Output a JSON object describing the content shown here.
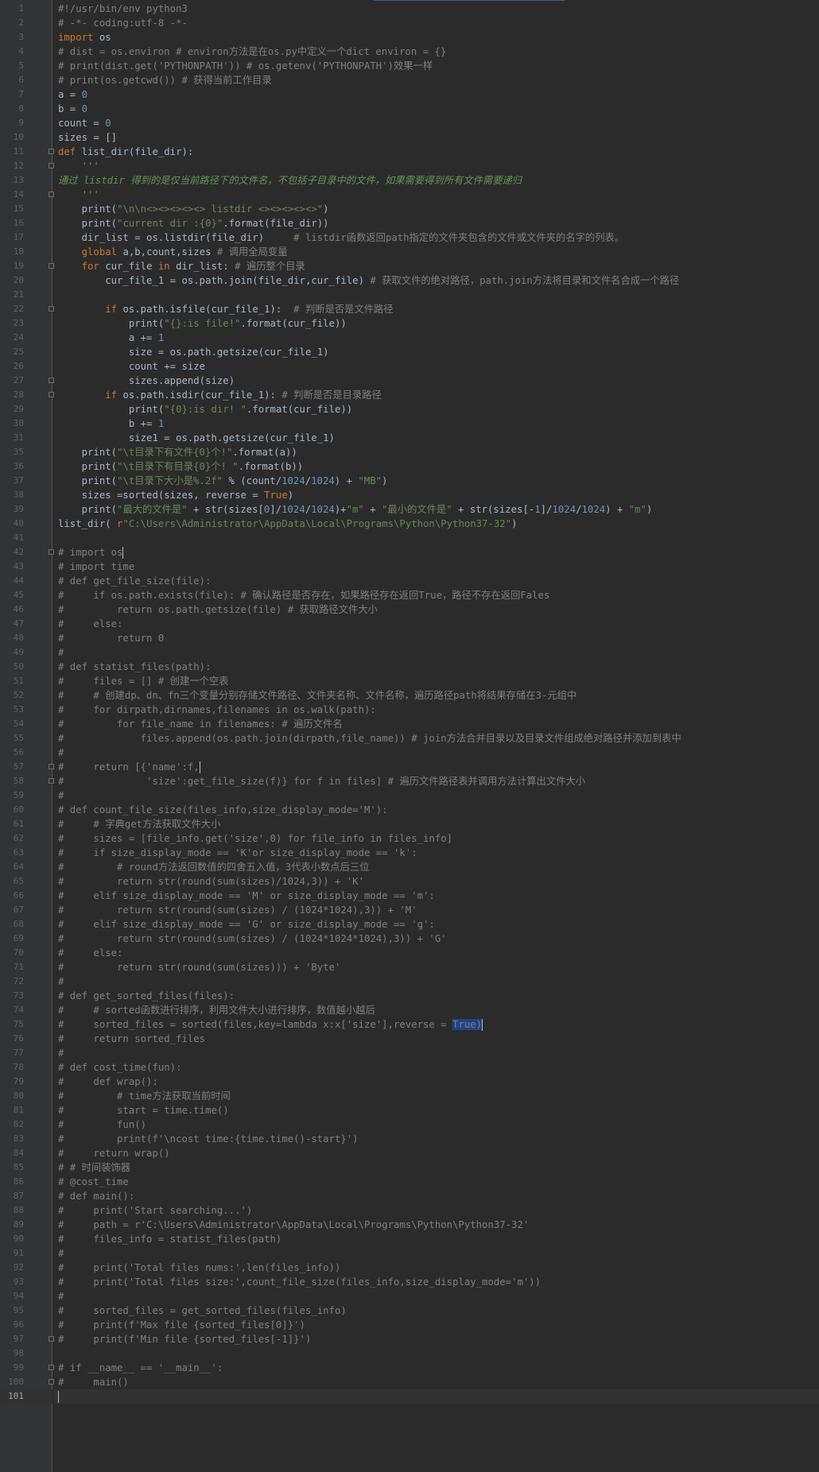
{
  "editor": {
    "current_line": 101,
    "lines": [
      {
        "n": 1,
        "text": "#!/usr/bin/env python3",
        "kind": "comment"
      },
      {
        "n": 2,
        "text": "# -*- coding:utf-8 -*-",
        "kind": "comment"
      },
      {
        "n": 3,
        "text": "import os",
        "kind": "import"
      },
      {
        "n": 4,
        "text": "# dist = os.environ # environ方法是在os.py中定义一个dict environ = {}",
        "kind": "comment"
      },
      {
        "n": 5,
        "text": "# print(dist.get('PYTHONPATH')) # os.getenv('PYTHONPATH')效果一样",
        "kind": "comment"
      },
      {
        "n": 6,
        "text": "# print(os.getcwd()) # 获得当前工作目录",
        "kind": "comment"
      },
      {
        "n": 7,
        "text": "a = 0",
        "kind": "code"
      },
      {
        "n": 8,
        "text": "b = 0",
        "kind": "code"
      },
      {
        "n": 9,
        "text": "count = 0",
        "kind": "code"
      },
      {
        "n": 10,
        "text": "sizes = []",
        "kind": "code"
      },
      {
        "n": 11,
        "text": "def list_dir(file_dir):",
        "kind": "def"
      },
      {
        "n": 12,
        "text": "    '''",
        "kind": "doc"
      },
      {
        "n": 13,
        "text": "通过 listdir 得到的是仅当前路径下的文件名，不包括子目录中的文件，如果需要得到所有文件需要递归",
        "kind": "doc"
      },
      {
        "n": 14,
        "text": "    '''",
        "kind": "doc"
      },
      {
        "n": 15,
        "text": "    print(\"\\n\\n<><><><><> listdir <><><><><>\")",
        "kind": "code"
      },
      {
        "n": 16,
        "text": "    print(\"current dir :{0}\".format(file_dir))",
        "kind": "code"
      },
      {
        "n": 17,
        "text": "    dir_list = os.listdir(file_dir)     # listdir函数返回path指定的文件夹包含的文件或文件夹的名字的列表。",
        "kind": "code"
      },
      {
        "n": 18,
        "text": "    global a,b,count,sizes # 调用全局变量",
        "kind": "code"
      },
      {
        "n": 19,
        "text": "    for cur_file in dir_list: # 遍历整个目录",
        "kind": "code"
      },
      {
        "n": 20,
        "text": "        cur_file_1 = os.path.join(file_dir,cur_file) # 获取文件的绝对路径，path.join方法将目录和文件名合成一个路径",
        "kind": "code"
      },
      {
        "n": 21,
        "text": "",
        "kind": "code"
      },
      {
        "n": 22,
        "text": "        if os.path.isfile(cur_file_1):  # 判断是否是文件路径",
        "kind": "code"
      },
      {
        "n": 23,
        "text": "            print(\"{}:is file!\".format(cur_file))",
        "kind": "code"
      },
      {
        "n": 24,
        "text": "            a += 1",
        "kind": "code"
      },
      {
        "n": 25,
        "text": "            size = os.path.getsize(cur_file_1)",
        "kind": "code"
      },
      {
        "n": 26,
        "text": "            count += size",
        "kind": "code"
      },
      {
        "n": 27,
        "text": "            sizes.append(size)",
        "kind": "code"
      },
      {
        "n": 28,
        "text": "        if os.path.isdir(cur_file_1): # 判断是否是目录路径",
        "kind": "code"
      },
      {
        "n": 29,
        "text": "            print(\"{0}:is dir! \".format(cur_file))",
        "kind": "code"
      },
      {
        "n": 30,
        "text": "            b += 1",
        "kind": "code"
      },
      {
        "n": 31,
        "text": "            size1 = os.path.getsize(cur_file_1)",
        "kind": "code"
      },
      {
        "n": 35,
        "text": "    print(\"\\t目录下有文件{0}个!\".format(a))",
        "kind": "code"
      },
      {
        "n": 36,
        "text": "    print(\"\\t目录下有目录{0}个! \".format(b))",
        "kind": "code"
      },
      {
        "n": 37,
        "text": "    print(\"\\t目录下大小是%.2f\" % (count/1024/1024) + \"MB\")",
        "kind": "code"
      },
      {
        "n": 38,
        "text": "    sizes =sorted(sizes, reverse = True)",
        "kind": "code"
      },
      {
        "n": 39,
        "text": "    print(\"最大的文件是\" + str(sizes[0]/1024/1024)+\"m\" + \"最小的文件是\" + str(sizes[-1]/1024/1024) + \"m\")",
        "kind": "code"
      },
      {
        "n": 40,
        "text": "list_dir( r\"C:\\Users\\Administrator\\AppData\\Local\\Programs\\Python\\Python37-32\")",
        "kind": "code"
      },
      {
        "n": 41,
        "text": "",
        "kind": "code"
      },
      {
        "n": 42,
        "text": "# import os",
        "kind": "comment"
      },
      {
        "n": 43,
        "text": "# import time",
        "kind": "comment"
      },
      {
        "n": 44,
        "text": "# def get_file_size(file):",
        "kind": "comment"
      },
      {
        "n": 45,
        "text": "#     if os.path.exists(file): # 确认路径是否存在，如果路径存在返回True，路径不存在返回Fales",
        "kind": "comment"
      },
      {
        "n": 46,
        "text": "#         return os.path.getsize(file) # 获取路径文件大小",
        "kind": "comment"
      },
      {
        "n": 47,
        "text": "#     else:",
        "kind": "comment"
      },
      {
        "n": 48,
        "text": "#         return 0",
        "kind": "comment"
      },
      {
        "n": 49,
        "text": "#",
        "kind": "comment"
      },
      {
        "n": 50,
        "text": "# def statist_files(path):",
        "kind": "comment"
      },
      {
        "n": 51,
        "text": "#     files = [] # 创建一个空表",
        "kind": "comment"
      },
      {
        "n": 52,
        "text": "#     # 创建dp、dn、fn三个变量分别存储文件路径、文件夹名称、文件名称，遍历路径path将结果存储在3-元组中",
        "kind": "comment"
      },
      {
        "n": 53,
        "text": "#     for dirpath,dirnames,filenames in os.walk(path):",
        "kind": "comment"
      },
      {
        "n": 54,
        "text": "#         for file_name in filenames: # 遍历文件名",
        "kind": "comment"
      },
      {
        "n": 55,
        "text": "#             files.append(os.path.join(dirpath,file_name)) # join方法合并目录以及目录文件组成绝对路径并添加到表中",
        "kind": "comment"
      },
      {
        "n": 56,
        "text": "#",
        "kind": "comment"
      },
      {
        "n": 57,
        "text": "#     return [{'name':f,",
        "kind": "comment"
      },
      {
        "n": 58,
        "text": "#              'size':get_file_size(f)} for f in files] # 遍历文件路径表并调用方法计算出文件大小",
        "kind": "comment"
      },
      {
        "n": 59,
        "text": "#",
        "kind": "comment"
      },
      {
        "n": 60,
        "text": "# def count_file_size(files_info,size_display_mode='M'):",
        "kind": "comment"
      },
      {
        "n": 61,
        "text": "#     # 字典get方法获取文件大小",
        "kind": "comment"
      },
      {
        "n": 62,
        "text": "#     sizes = [file_info.get('size',0) for file_info in files_info]",
        "kind": "comment"
      },
      {
        "n": 63,
        "text": "#     if size_display_mode == 'K'or size_display_mode == 'k':",
        "kind": "comment"
      },
      {
        "n": 64,
        "text": "#         # round方法返回数值的四舍五入值，3代表小数点后三位",
        "kind": "comment"
      },
      {
        "n": 65,
        "text": "#         return str(round(sum(sizes)/1024,3)) + 'K'",
        "kind": "comment"
      },
      {
        "n": 66,
        "text": "#     elif size_display_mode == 'M' or size_display_mode == 'm':",
        "kind": "comment"
      },
      {
        "n": 67,
        "text": "#         return str(round(sum(sizes) / (1024*1024),3)) + 'M'",
        "kind": "comment"
      },
      {
        "n": 68,
        "text": "#     elif size_display_mode == 'G' or size_display_mode == 'g':",
        "kind": "comment"
      },
      {
        "n": 69,
        "text": "#         return str(round(sum(sizes) / (1024*1024*1024),3)) + 'G'",
        "kind": "comment"
      },
      {
        "n": 70,
        "text": "#     else:",
        "kind": "comment"
      },
      {
        "n": 71,
        "text": "#         return str(round(sum(sizes))) + 'Byte'",
        "kind": "comment"
      },
      {
        "n": 72,
        "text": "#",
        "kind": "comment"
      },
      {
        "n": 73,
        "text": "# def get_sorted_files(files):",
        "kind": "comment"
      },
      {
        "n": 74,
        "text": "#     # sorted函数进行排序，利用文件大小进行排序，数值越小越后",
        "kind": "comment"
      },
      {
        "n": 75,
        "text": "#     sorted_files = sorted(files,key=lambda x:x['size'],reverse = True)",
        "kind": "comment"
      },
      {
        "n": 76,
        "text": "#     return sorted_files",
        "kind": "comment"
      },
      {
        "n": 77,
        "text": "#",
        "kind": "comment"
      },
      {
        "n": 78,
        "text": "# def cost_time(fun):",
        "kind": "comment"
      },
      {
        "n": 79,
        "text": "#     def wrap():",
        "kind": "comment"
      },
      {
        "n": 80,
        "text": "#         # time方法获取当前时间",
        "kind": "comment"
      },
      {
        "n": 81,
        "text": "#         start = time.time()",
        "kind": "comment"
      },
      {
        "n": 82,
        "text": "#         fun()",
        "kind": "comment"
      },
      {
        "n": 83,
        "text": "#         print(f'\\ncost time:{time.time()-start}')",
        "kind": "comment"
      },
      {
        "n": 84,
        "text": "#     return wrap()",
        "kind": "comment"
      },
      {
        "n": 85,
        "text": "# # 时间装饰器",
        "kind": "comment"
      },
      {
        "n": 86,
        "text": "# @cost_time",
        "kind": "comment"
      },
      {
        "n": 87,
        "text": "# def main():",
        "kind": "comment"
      },
      {
        "n": 88,
        "text": "#     print('Start searching...')",
        "kind": "comment"
      },
      {
        "n": 89,
        "text": "#     path = r'C:\\Users\\Administrator\\AppData\\Local\\Programs\\Python\\Python37-32'",
        "kind": "comment"
      },
      {
        "n": 90,
        "text": "#     files_info = statist_files(path)",
        "kind": "comment"
      },
      {
        "n": 91,
        "text": "#",
        "kind": "comment"
      },
      {
        "n": 92,
        "text": "#     print('Total files nums:',len(files_info))",
        "kind": "comment"
      },
      {
        "n": 93,
        "text": "#     print('Total files size:',count_file_size(files_info,size_display_mode='m'))",
        "kind": "comment"
      },
      {
        "n": 94,
        "text": "#",
        "kind": "comment"
      },
      {
        "n": 95,
        "text": "#     sorted_files = get_sorted_files(files_info)",
        "kind": "comment"
      },
      {
        "n": 96,
        "text": "#     print(f'Max file {sorted_files[0]}')",
        "kind": "comment"
      },
      {
        "n": 97,
        "text": "#     print(f'Min file {sorted_files[-1]}')",
        "kind": "comment"
      },
      {
        "n": 98,
        "text": "",
        "kind": "code"
      },
      {
        "n": 99,
        "text": "# if __name__ == '__main__':",
        "kind": "comment"
      },
      {
        "n": 100,
        "text": "#     main()",
        "kind": "comment"
      },
      {
        "n": 101,
        "text": "",
        "kind": "code"
      }
    ]
  },
  "overlay_fragment": "    print(\"\\t目录下有文件{0}个!\".format(a))"
}
